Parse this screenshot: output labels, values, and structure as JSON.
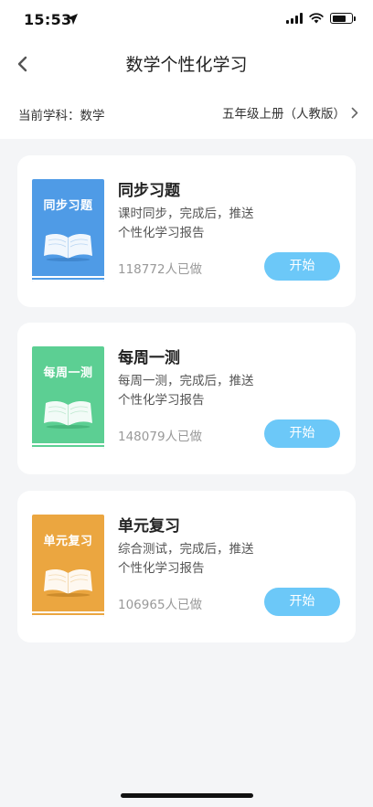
{
  "status_bar": {
    "time": "15:53"
  },
  "nav": {
    "title": "数学个性化学习",
    "back_icon": "chevron-left-icon"
  },
  "subject": {
    "label": "当前学科：数学",
    "grade": "五年级上册（人教版）",
    "chevron_icon": "chevron-right-icon"
  },
  "cards": [
    {
      "book_label": "同步习题",
      "title": "同步习题",
      "desc_line1": "课时同步，完成后，推送",
      "desc_line2": "个性化学习报告",
      "count": "118772人已做",
      "button": "开始",
      "color": "#4f9be6"
    },
    {
      "book_label": "每周一测",
      "title": "每周一测",
      "desc_line1": "每周一测，完成后，推送",
      "desc_line2": "个性化学习报告",
      "count": "148079人已做",
      "button": "开始",
      "color": "#5ccf93"
    },
    {
      "book_label": "单元复习",
      "title": "单元复习",
      "desc_line1": "综合测试，完成后，推送",
      "desc_line2": "个性化学习报告",
      "count": "106965人已做",
      "button": "开始",
      "color": "#eba640"
    }
  ],
  "theme": {
    "button_color": "#6cc8f8",
    "page_bg": "#f4f5f7"
  }
}
